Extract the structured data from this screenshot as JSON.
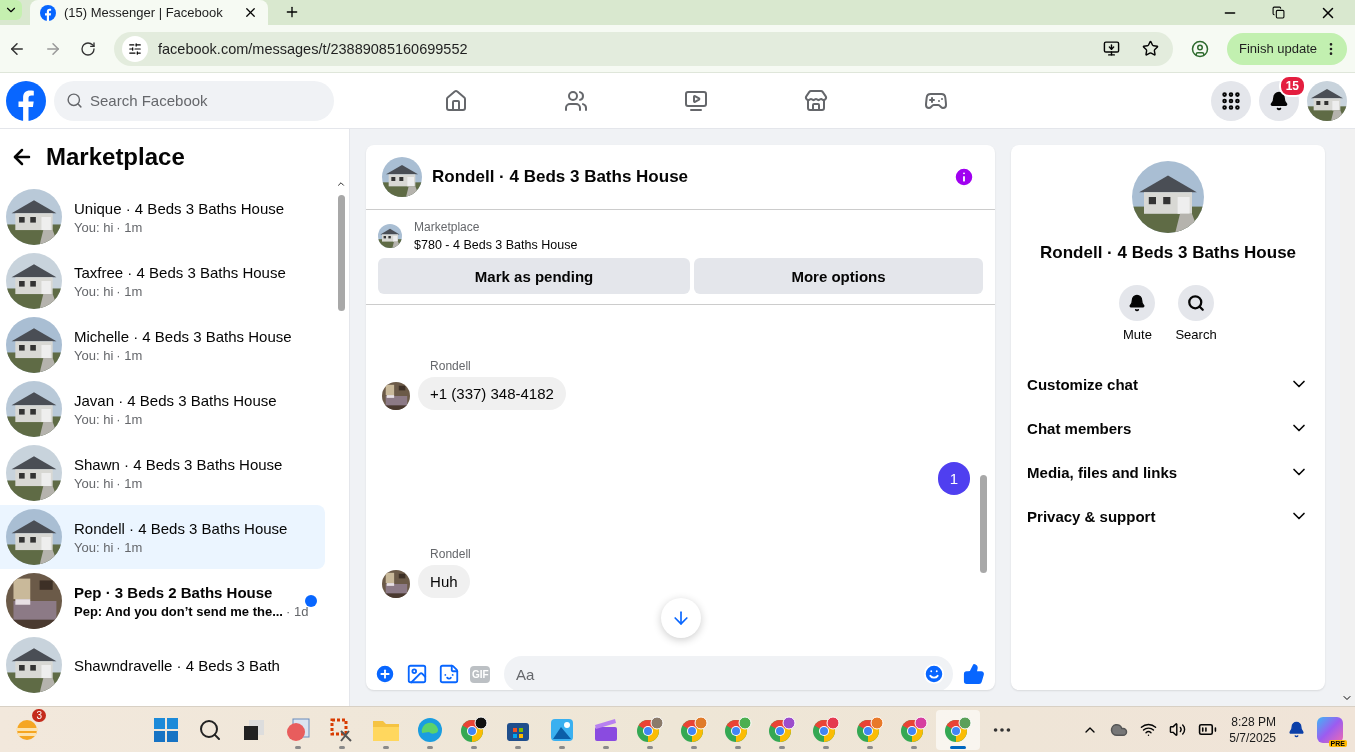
{
  "browser": {
    "tab_title": "(15) Messenger | Facebook",
    "url": "facebook.com/messages/t/23889085160699552",
    "update_button": "Finish update"
  },
  "header": {
    "search_placeholder": "Search Facebook",
    "nav": [
      {
        "kind": "home"
      },
      {
        "kind": "friends"
      },
      {
        "kind": "video"
      },
      {
        "kind": "marketplace"
      },
      {
        "kind": "gaming"
      }
    ],
    "notification_count": "15"
  },
  "sidebar": {
    "title": "Marketplace",
    "conversations": [
      {
        "name": "Unique · 4 Beds 3 Baths House",
        "preview": "You: hi",
        "time": "· 1m",
        "unread": false,
        "selected": false
      },
      {
        "name": "Taxfree · 4 Beds 3 Baths House",
        "preview": "You: hi",
        "time": "· 1m",
        "unread": false,
        "selected": false
      },
      {
        "name": "Michelle · 4 Beds 3 Baths House",
        "preview": "You: hi",
        "time": "· 1m",
        "unread": false,
        "selected": false
      },
      {
        "name": "Javan · 4 Beds 3 Baths House",
        "preview": "You: hi",
        "time": "· 1m",
        "unread": false,
        "selected": false
      },
      {
        "name": "Shawn · 4 Beds 3 Baths House",
        "preview": "You: hi",
        "time": "· 1m",
        "unread": false,
        "selected": false
      },
      {
        "name": "Rondell · 4 Beds 3 Baths House",
        "preview": "You: hi",
        "time": "· 1m",
        "unread": false,
        "selected": true
      },
      {
        "name": "Pep · 3 Beds 2 Baths House",
        "preview": "Pep: And you don’t send me the...",
        "time": "· 1d",
        "unread": true,
        "selected": false
      },
      {
        "name": "Shawndravelle · 4 Beds 3 Bath",
        "selected": false,
        "unread": false
      }
    ]
  },
  "chat": {
    "title": "Rondell · 4 Beds 3 Baths House",
    "listing": {
      "label": "Marketplace",
      "title": "$780 - 4 Beds 3 Baths House"
    },
    "actions": [
      "Mark as pending",
      "More options"
    ],
    "messages": [
      {
        "kind": "incoming",
        "sender": "Rondell",
        "text": "+1 (337) 348-4182"
      },
      {
        "kind": "outgoing",
        "text": "1"
      },
      {
        "kind": "incoming",
        "sender": "Rondell",
        "text": "Huh"
      }
    ],
    "composer": {
      "gif_label": "GIF",
      "placeholder": "Aa"
    }
  },
  "details": {
    "name": "Rondell · 4 Beds 3 Baths House",
    "actions": [
      {
        "kind": "mute",
        "label": "Mute"
      },
      {
        "kind": "search",
        "label": "Search"
      }
    ],
    "sections": [
      {
        "label": "Customize chat",
        "expanded": false
      },
      {
        "label": "Chat members",
        "expanded": false
      },
      {
        "label": "Media, files and links",
        "expanded": false
      },
      {
        "label": "Privacy & support",
        "expanded": false
      }
    ]
  },
  "taskbar": {
    "weather_badge": "3",
    "apps": [
      {
        "kind": "start",
        "selected": false
      },
      {
        "kind": "search",
        "selected": false
      },
      {
        "kind": "taskview",
        "selected": false
      },
      {
        "kind": "paint",
        "selected": false
      },
      {
        "kind": "snip",
        "selected": false
      },
      {
        "kind": "files",
        "selected": false
      },
      {
        "kind": "edge",
        "selected": false
      },
      {
        "kind": "chrome",
        "color": "#111111",
        "selected": false
      },
      {
        "kind": "store",
        "selected": false
      },
      {
        "kind": "photos",
        "selected": false
      },
      {
        "kind": "clipchamp",
        "selected": false
      },
      {
        "kind": "chrome",
        "color": "#8a7a6a",
        "selected": false
      },
      {
        "kind": "chrome",
        "color": "#e07b2a",
        "selected": false
      },
      {
        "kind": "chrome",
        "color": "#4caf50",
        "selected": false
      },
      {
        "kind": "chrome",
        "color": "#9c4dcc",
        "selected": false
      },
      {
        "kind": "chrome",
        "color": "#e53950",
        "selected": false
      },
      {
        "kind": "chrome",
        "color": "#e8792a",
        "selected": false
      },
      {
        "kind": "chrome",
        "color": "#d63fa0",
        "selected": false
      },
      {
        "kind": "chrome",
        "color": "#5aa05a",
        "selected": true
      },
      {
        "kind": "more",
        "selected": false
      }
    ],
    "time": "8:28 PM",
    "date": "5/7/2025",
    "copilot_badge": "PRE"
  }
}
